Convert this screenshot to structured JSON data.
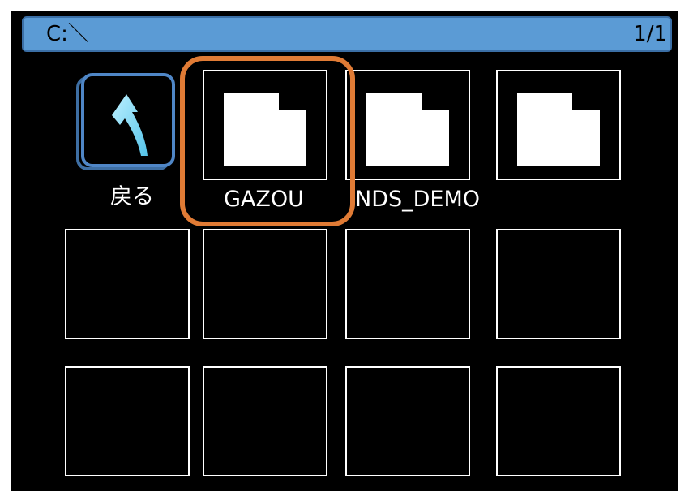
{
  "header": {
    "path": "C:＼",
    "page_indicator": "1/1"
  },
  "items": [
    {
      "label": "戻る",
      "type": "back",
      "icon": "back-arrow-icon"
    },
    {
      "label": "GAZOU",
      "type": "folder",
      "icon": "folder-icon",
      "selected": true
    },
    {
      "label": "NDS_DEMO",
      "type": "folder",
      "icon": "folder-icon"
    },
    {
      "label": "",
      "type": "folder",
      "icon": "folder-icon"
    }
  ],
  "colors": {
    "path_bar": "#5b9bd5",
    "selection_ring": "#e07b35",
    "back_arrow": "#7fd8f4",
    "tile_border": "#ffffff",
    "background": "#000000"
  }
}
